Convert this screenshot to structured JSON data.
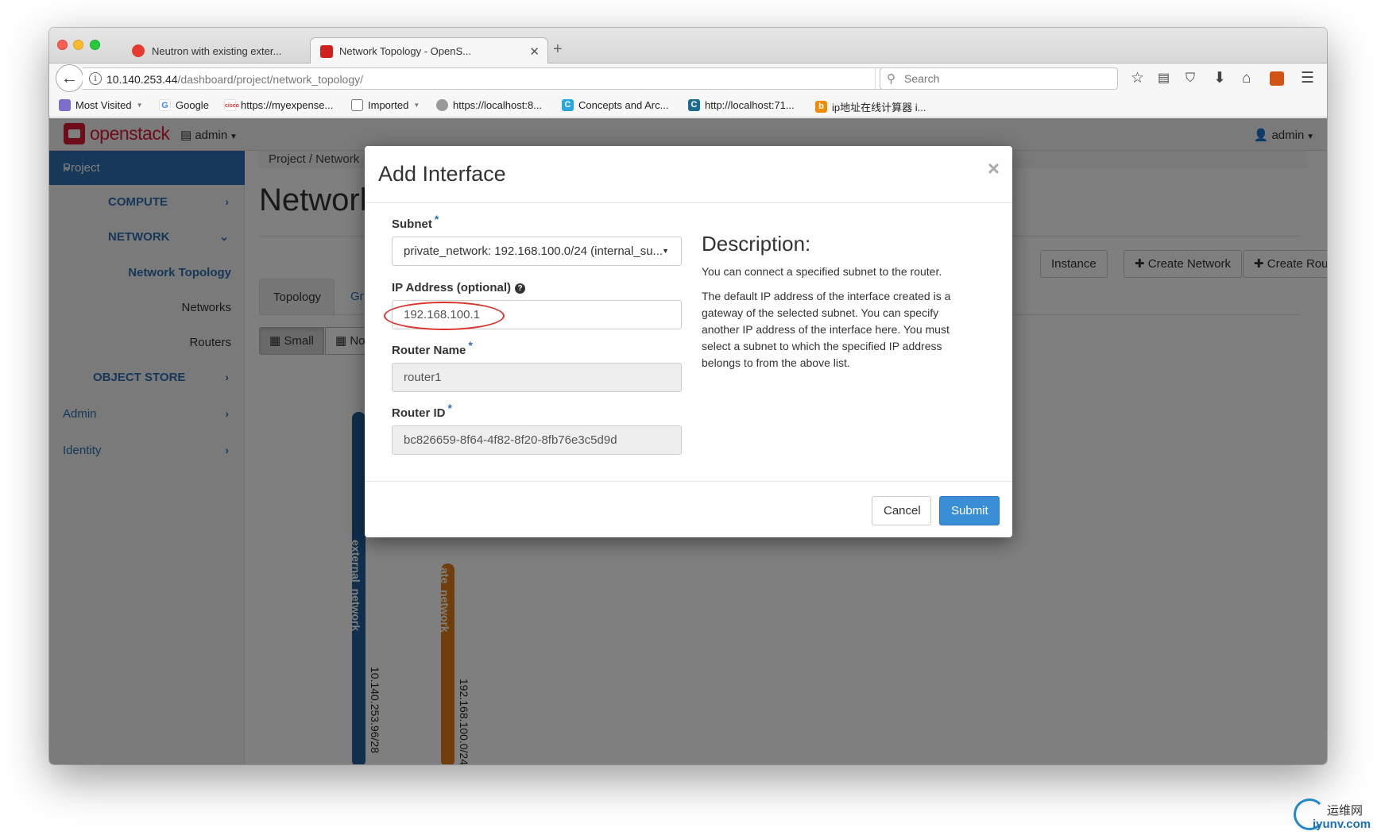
{
  "browser": {
    "tabs": [
      {
        "title": "Neutron with existing exter...",
        "active": false
      },
      {
        "title": "Network Topology - OpenS...",
        "active": true
      }
    ],
    "url_host": "10.140.253.44",
    "url_path": "/dashboard/project/network_topology/",
    "search_placeholder": "Search",
    "bookmarks": [
      "Most Visited",
      "Google",
      "https://myexpense...",
      "Imported",
      "https://localhost:8...",
      "Concepts and Arc...",
      "http://localhost:71...",
      "ip地址在线计算器 i..."
    ]
  },
  "app": {
    "brand": "openstack",
    "project_selector": "admin",
    "user_menu": "admin",
    "sidebar": {
      "project": "Project",
      "compute": "COMPUTE",
      "network": "NETWORK",
      "network_topology": "Network Topology",
      "networks": "Networks",
      "routers": "Routers",
      "object_store": "OBJECT STORE",
      "admin": "Admin",
      "identity": "Identity"
    },
    "breadcrumb": "Project /  Network",
    "page_title": "Network",
    "actions": {
      "instance": "Instance",
      "create_network": "Create Network",
      "create_router": "Create Router"
    },
    "tabs": {
      "topology": "Topology",
      "graph": "Gr"
    },
    "size_buttons": {
      "small": "Small",
      "normal": "No"
    },
    "topology": {
      "external_network": {
        "name": "external_network",
        "cidr": "10.140.253.96/28",
        "color": "#1f5f9a"
      },
      "private_network": {
        "name": "ate_network",
        "cidr": "192.168.100.0/24",
        "color": "#e07a18"
      }
    }
  },
  "modal": {
    "title": "Add Interface",
    "subnet_label": "Subnet",
    "subnet_value": "private_network: 192.168.100.0/24 (internal_su...",
    "ip_label": "IP Address (optional)",
    "ip_value": "192.168.100.1",
    "router_name_label": "Router Name",
    "router_name_value": "router1",
    "router_id_label": "Router ID",
    "router_id_value": "bc826659-8f64-4f82-8f20-8fb76e3c5d9d",
    "description_title": "Description:",
    "description_p1": "You can connect a specified subnet to the router.",
    "description_p2": "The default IP address of the interface created is a gateway of the selected subnet. You can specify another IP address of the interface here. You must select a subnet to which the specified IP address belongs to from the above list.",
    "cancel": "Cancel",
    "submit": "Submit",
    "annotation_color": "#d9332c"
  },
  "watermark": {
    "cn": "运维网",
    "site": "iyunv.com"
  }
}
